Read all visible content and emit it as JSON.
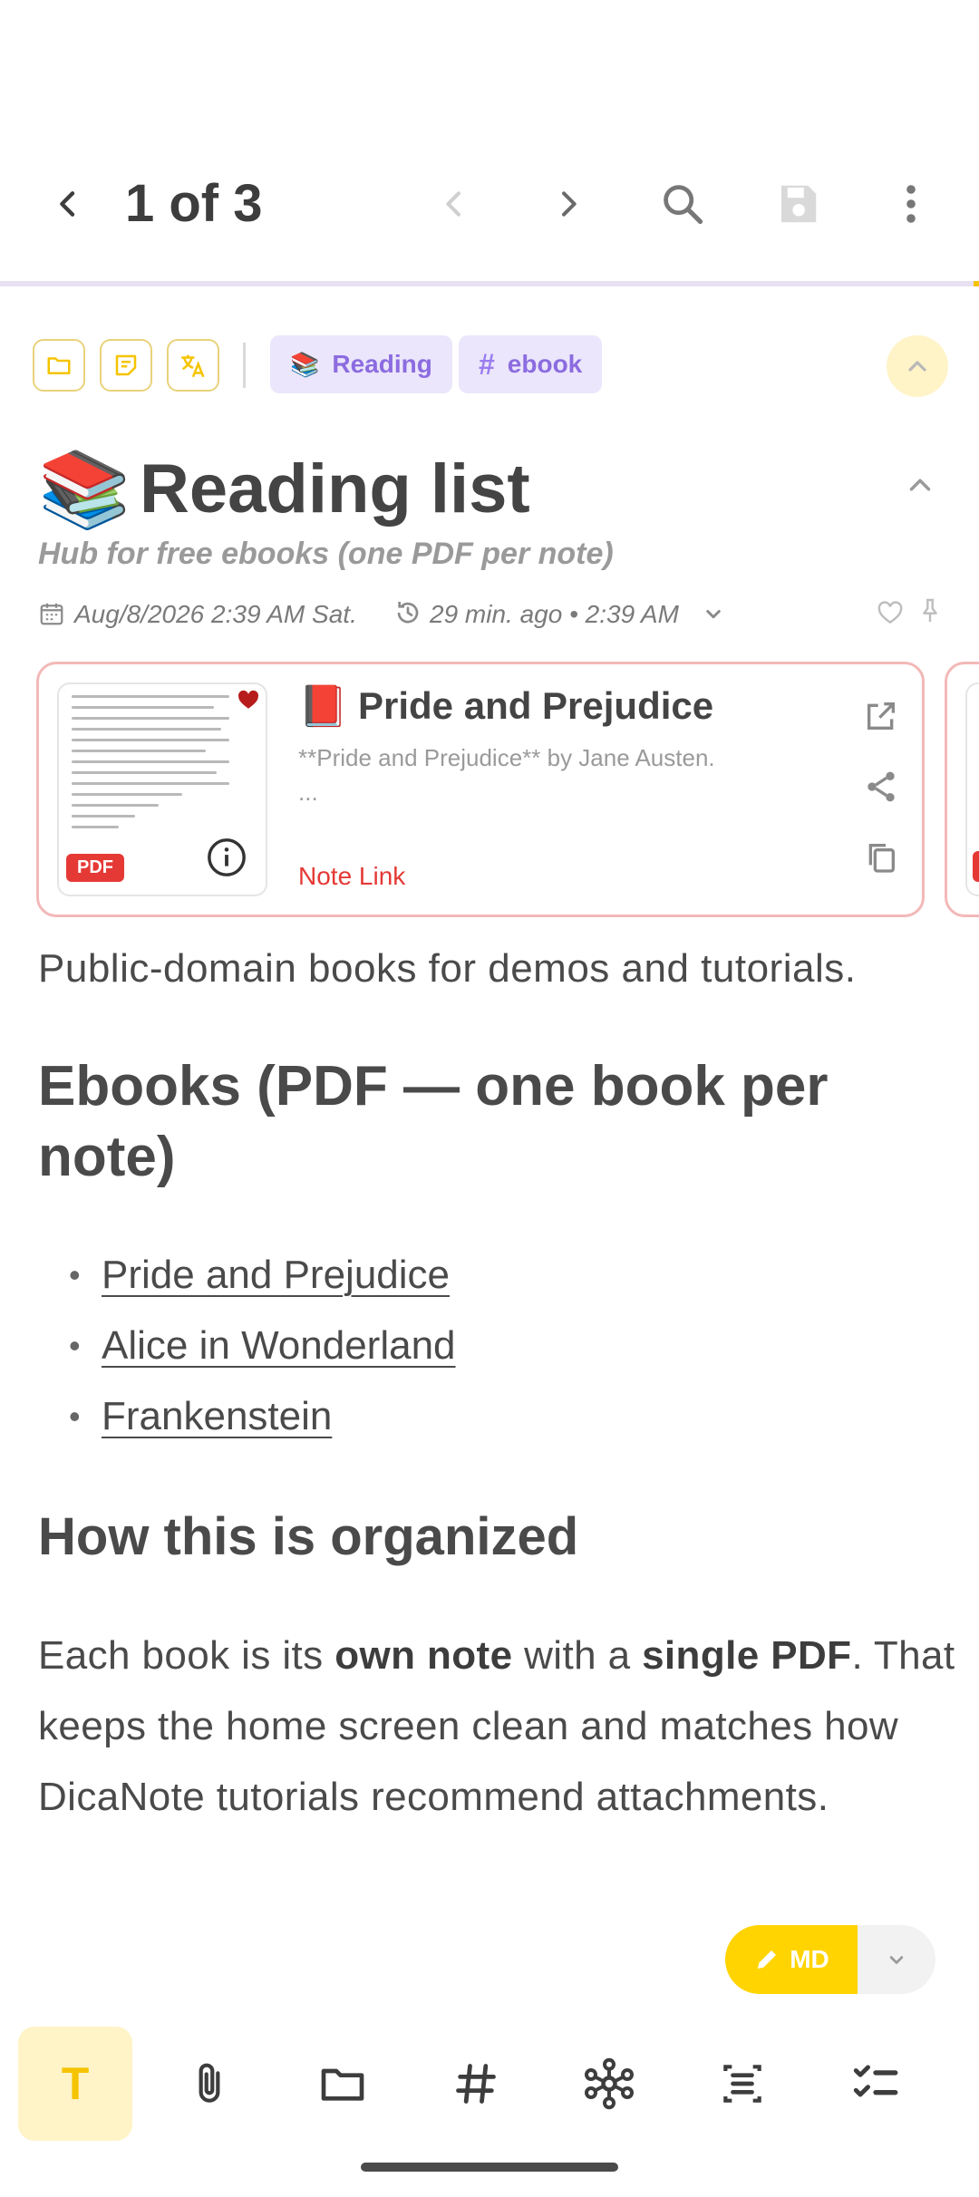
{
  "appbar": {
    "counter": "1 of 3"
  },
  "chips": {
    "tags": [
      {
        "emoji": "📚",
        "label": "Reading"
      },
      {
        "hash": "#",
        "label": "ebook"
      }
    ]
  },
  "note": {
    "emoji": "📚",
    "title": "Reading list",
    "subtitle": "Hub for free ebooks (one PDF per note)",
    "created": "Aug/8/2026 2:39 AM Sat.",
    "modified": "29 min. ago • 2:39 AM"
  },
  "attachment": {
    "badge": "PDF",
    "emoji": "📕",
    "title": "Pride and Prejudice",
    "description": "**Pride and Prejudice** by Jane Austen.",
    "more": "...",
    "link_label": "Note Link"
  },
  "content": {
    "intro": "Public-domain books for demos and tutorials.",
    "heading1": "Ebooks (PDF — one book per note)",
    "books": [
      "Pride and Prejudice",
      "Alice in Wonderland",
      "Frankenstein"
    ],
    "heading2": "How this is organized",
    "para_a": "Each book is its ",
    "para_b": "own note",
    "para_c": " with a ",
    "para_d": "single PDF",
    "para_e": ". That keeps the home screen clean and matches how DicaNote tutorials recommend attachments."
  },
  "fab": {
    "label": "MD"
  },
  "toolbar": {
    "text_label": "T"
  },
  "colors": {
    "accent": "#ffd400",
    "tag_bg": "#ebe6fb",
    "tag_text": "#8c6ce0",
    "link_red": "#e53935"
  }
}
